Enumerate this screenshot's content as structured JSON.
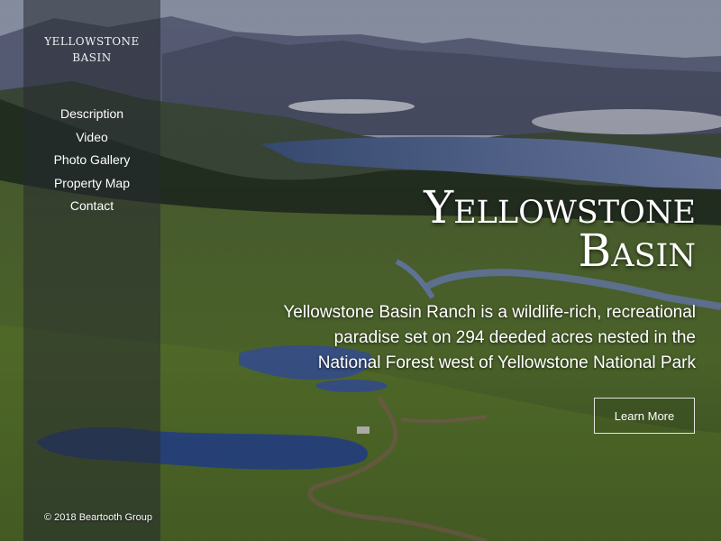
{
  "sidebar": {
    "brand_line1": "Yellowstone",
    "brand_line2": "Basin",
    "nav": [
      {
        "label": "Description"
      },
      {
        "label": "Video"
      },
      {
        "label": "Photo Gallery"
      },
      {
        "label": "Property Map"
      },
      {
        "label": "Contact"
      }
    ]
  },
  "hero": {
    "title_line1": "Yellowstone",
    "title_line2": "Basin",
    "description": "Yellowstone Basin Ranch is a wildlife-rich, recreational paradise set on 294 deeded acres nested in the National Forest west of Yellowstone National Park",
    "button_label": "Learn More"
  },
  "footer": {
    "copyright": "© 2018 Beartooth Group"
  },
  "colors": {
    "sidebar_bg": "#262a30",
    "text": "#ffffff"
  }
}
